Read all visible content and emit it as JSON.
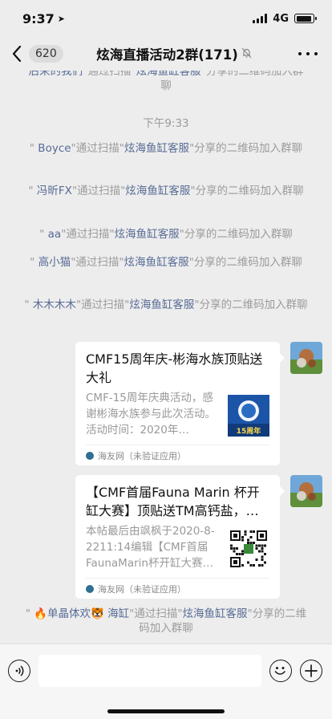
{
  "status_bar": {
    "time": "9:37",
    "network": "4G",
    "battery_level": 0.9
  },
  "nav": {
    "unread_count": "620",
    "title": "炫海直播活动2群(171)"
  },
  "messages": [
    {
      "kind": "system",
      "cut_prefix": "后来的我们",
      "middle": "通过扫描",
      "target": "炫海鱼缸客服",
      "suffix": "分享的二维码加入群聊"
    },
    {
      "kind": "time",
      "text": "下午9:33"
    },
    {
      "kind": "system",
      "q_open": "\"",
      "name": " Boyce",
      "q_close": "\"通过扫描\"",
      "target": "炫海鱼缸客服",
      "suffix": "\"分享的二维码加入群聊"
    },
    {
      "kind": "system",
      "q_open": "\"",
      "name": " 冯昕FX",
      "q_close": "\"通过扫描\"",
      "target": "炫海鱼缸客服",
      "suffix": "\"分享的二维码加入群聊"
    },
    {
      "kind": "system",
      "q_open": "\"",
      "name": " aa",
      "q_close": "\"通过扫描\"",
      "target": "炫海鱼缸客服",
      "suffix": "\"分享的二维码加入群聊"
    },
    {
      "kind": "system",
      "q_open": "\"",
      "name": " 高小猫",
      "q_close": "\"通过扫描\"",
      "target": "炫海鱼缸客服",
      "suffix": "\"分享的二维码加入群聊"
    },
    {
      "kind": "system",
      "q_open": "\"",
      "name": " 木木木木",
      "q_close": "\"通过扫描\"",
      "target": "炫海鱼缸客服",
      "suffix": "\"分享的二维码加入群聊"
    },
    {
      "kind": "card",
      "title": "CMF15周年庆-彬海水族顶贴送大礼",
      "desc": "CMF-15周年庆典活动，感谢彬海水族参与此次活动。活动时间：2020年…",
      "thumb_label": "15周年",
      "source": "海友网（未验证应用）"
    },
    {
      "kind": "card",
      "title": "【CMF首届Fauna Marin 杯开缸大赛】顶贴送TM高钙盐，…",
      "desc": "本帖最后由飒枫于2020-8-2211:14编辑【CMF首届FaunaMarin杯开缸大赛…",
      "thumb_label": "",
      "source": "海友网（未验证应用）"
    },
    {
      "kind": "system",
      "q_open": "\"",
      "name": " 🔥单晶体欢🐯 海缸",
      "q_close": "\"通过扫描\"",
      "target": "炫海鱼缸客服",
      "suffix": "\"分享的二维码加入群聊"
    }
  ],
  "colors": {
    "link": "#576b95",
    "system_text": "#9b9b9b",
    "background": "#ededed"
  },
  "icons": [
    "back-chevron-icon",
    "mute-bell-icon",
    "more-icon",
    "voice-icon",
    "emoji-icon",
    "plus-icon"
  ]
}
